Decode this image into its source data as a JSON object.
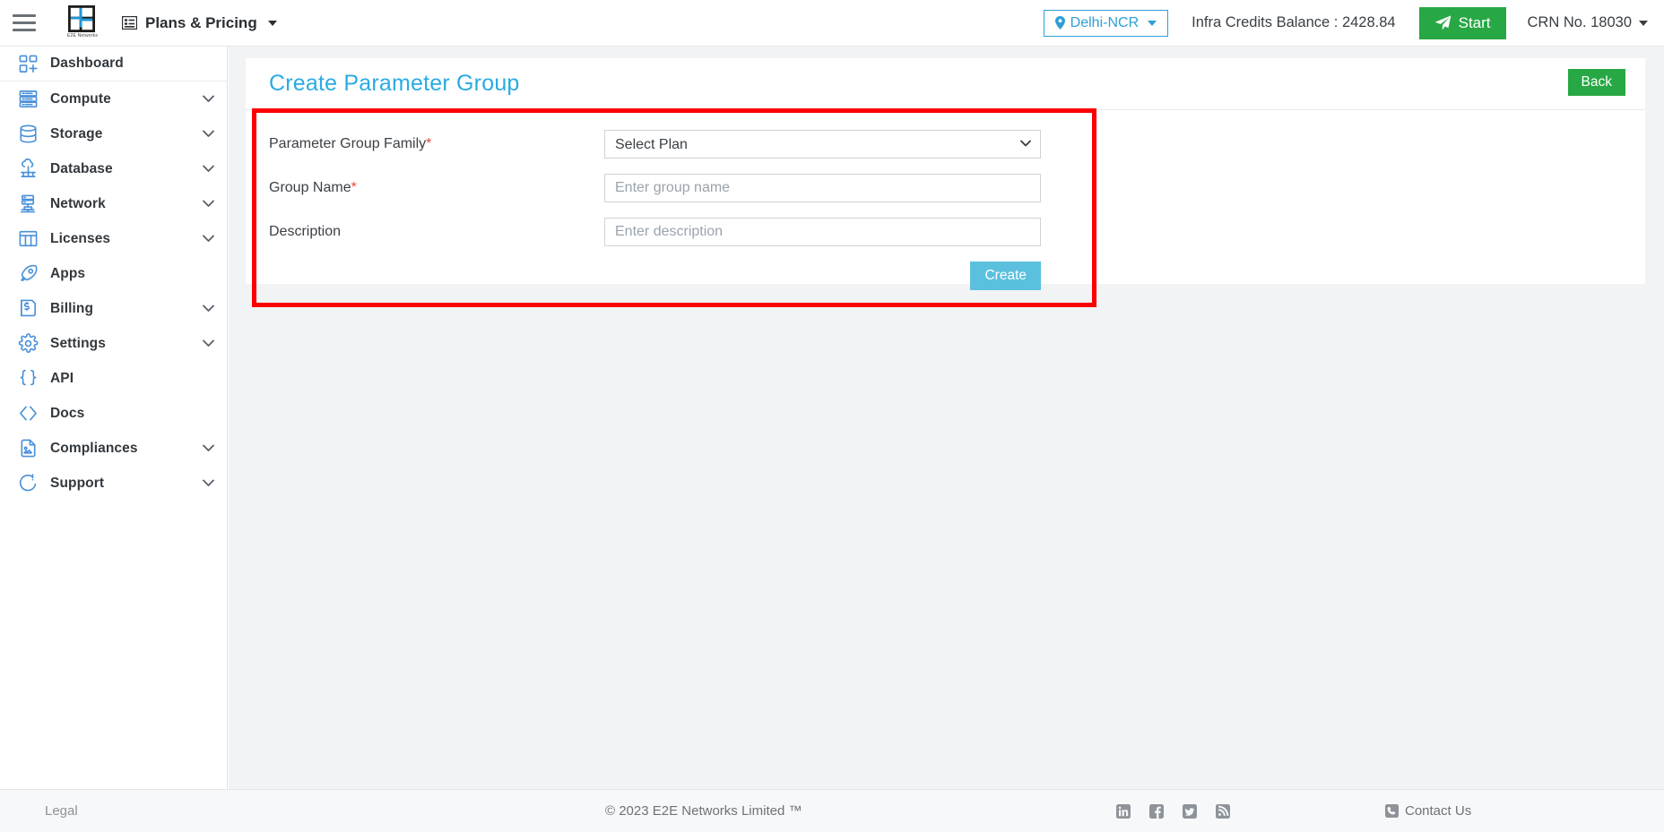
{
  "topbar": {
    "menu_icon": "hamburger-icon",
    "logo_text": "E2E Networks",
    "plans_pricing_label": "Plans & Pricing",
    "region_label": "Delhi-NCR",
    "credits_label": "Infra Credits Balance : 2428.84",
    "start_label": "Start",
    "crn_label": "CRN No. 18030"
  },
  "sidebar": {
    "items": [
      {
        "label": "Dashboard",
        "icon": "dashboard-icon",
        "chevron": false,
        "divider": true
      },
      {
        "label": "Compute",
        "icon": "server-icon",
        "chevron": true,
        "divider": false
      },
      {
        "label": "Storage",
        "icon": "database-icon",
        "chevron": true,
        "divider": false
      },
      {
        "label": "Database",
        "icon": "cloud-db-icon",
        "chevron": true,
        "divider": false
      },
      {
        "label": "Network",
        "icon": "network-icon",
        "chevron": true,
        "divider": false
      },
      {
        "label": "Licenses",
        "icon": "licenses-icon",
        "chevron": true,
        "divider": false
      },
      {
        "label": "Apps",
        "icon": "rocket-icon",
        "chevron": false,
        "divider": false
      },
      {
        "label": "Billing",
        "icon": "invoice-icon",
        "chevron": true,
        "divider": false
      },
      {
        "label": "Settings",
        "icon": "gear-icon",
        "chevron": true,
        "divider": false
      },
      {
        "label": "API",
        "icon": "braces-icon",
        "chevron": false,
        "divider": false
      },
      {
        "label": "Docs",
        "icon": "code-icon",
        "chevron": false,
        "divider": false
      },
      {
        "label": "Compliances",
        "icon": "document-icon",
        "chevron": true,
        "divider": false
      },
      {
        "label": "Support",
        "icon": "support-icon",
        "chevron": true,
        "divider": false
      }
    ]
  },
  "main": {
    "page_title": "Create Parameter Group",
    "back_label": "Back",
    "form": {
      "family_label": "Parameter Group Family",
      "family_required": "*",
      "family_value": "Select Plan",
      "family_options": [
        "Select Plan"
      ],
      "group_name_label": "Group Name",
      "group_name_required": "*",
      "group_name_value": "",
      "group_name_placeholder": "Enter group name",
      "description_label": "Description",
      "description_value": "",
      "description_placeholder": "Enter description",
      "create_label": "Create"
    }
  },
  "footer": {
    "legal_label": "Legal",
    "copyright": "© 2023 E2E Networks Limited ™",
    "social": [
      {
        "name": "linkedin-icon"
      },
      {
        "name": "facebook-icon"
      },
      {
        "name": "twitter-icon"
      },
      {
        "name": "rss-icon"
      }
    ],
    "contact_label": "Contact Us"
  },
  "colors": {
    "accent_blue": "#29abe2",
    "green": "#27a844",
    "create_blue": "#5bc0de",
    "annotation_red": "#fb0000",
    "icon_blue": "#4a90d9"
  }
}
